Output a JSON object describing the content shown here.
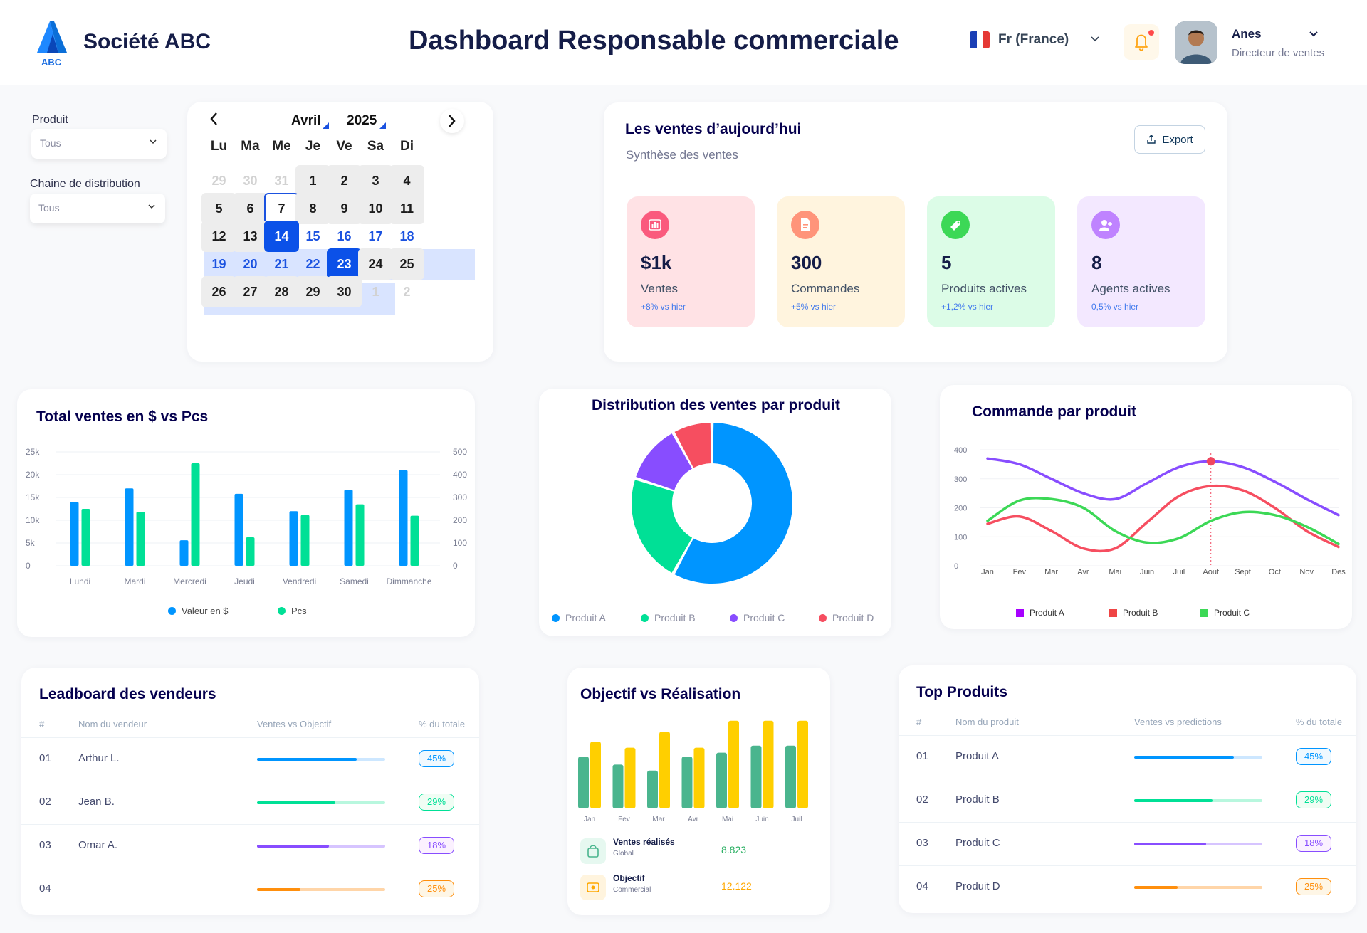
{
  "header": {
    "brand_logo_text": "ABC",
    "company": "Société ABC",
    "title": "Dashboard Responsable commerciale",
    "language": "Fr (France)",
    "user_name": "Anes",
    "user_role": "Directeur de ventes"
  },
  "filters": {
    "product_label": "Produit",
    "product_value": "Tous",
    "channel_label": "Chaine de distribution",
    "channel_value": "Tous"
  },
  "calendar": {
    "month": "Avril",
    "year": "2025",
    "weekdays": [
      "Lu",
      "Ma",
      "Me",
      "Je",
      "Ve",
      "Sa",
      "Di"
    ],
    "rows": [
      [
        "29",
        "30",
        "31",
        "1",
        "2",
        "3",
        "4"
      ],
      [
        "5",
        "6",
        "7",
        "8",
        "9",
        "10",
        "11"
      ],
      [
        "12",
        "13",
        "14",
        "15",
        "16",
        "17",
        "18"
      ],
      [
        "19",
        "20",
        "21",
        "22",
        "23",
        "24",
        "25"
      ],
      [
        "26",
        "27",
        "28",
        "29",
        "30",
        "1",
        "2"
      ]
    ]
  },
  "sales_today": {
    "title": "Les ventes d’aujourd’hui",
    "subtitle": "Synthèse des ventes",
    "export_label": "Export",
    "kpis": [
      {
        "value": "$1k",
        "label": "Ventes",
        "change": "+8%  vs hier",
        "bg": "#ffe2e5",
        "icon_bg": "#fa5a7d"
      },
      {
        "value": "300",
        "label": "Commandes",
        "change": "+5% vs hier",
        "bg": "#fff4de",
        "icon_bg": "#ff947a"
      },
      {
        "value": "5",
        "label": "Produits actives",
        "change": "+1,2% vs hier",
        "bg": "#dcfce7",
        "icon_bg": "#3cd856"
      },
      {
        "value": "8",
        "label": "Agents actives",
        "change": "0,5% vs hier",
        "bg": "#f3e8ff",
        "icon_bg": "#bf83ff"
      }
    ]
  },
  "total_sales": {
    "title": "Total ventes en $ vs Pcs",
    "legend": [
      "Valeur en $",
      "Pcs"
    ]
  },
  "distribution": {
    "title": "Distribution des ventes par produit",
    "legend": [
      "Produit A",
      "Produit B",
      "Produit C",
      "Produit D"
    ]
  },
  "orders": {
    "title": "Commande par produit",
    "legend": [
      "Produit A",
      "Produit B",
      "Produit C"
    ]
  },
  "objective": {
    "title": "Objectif vs Réalisation",
    "rows": [
      {
        "label": "Ventes réalisés",
        "sub": "Global",
        "value": "8.823"
      },
      {
        "label": "Objectif",
        "sub": "Commercial",
        "value": "12.122"
      }
    ]
  },
  "leaderboard": {
    "title": "Leadboard des vendeurs",
    "headers": [
      "#",
      "Nom du vendeur",
      "Ventes vs Objectif",
      "% du totale"
    ],
    "rows": [
      {
        "rank": "01",
        "name": "Arthur L.",
        "pct": "45%",
        "progress": 0.78
      },
      {
        "rank": "02",
        "name": "Jean B.",
        "pct": "29%",
        "progress": 0.61
      },
      {
        "rank": "03",
        "name": "Omar A.",
        "pct": "18%",
        "progress": 0.56
      },
      {
        "rank": "04",
        "name": "",
        "pct": "25%",
        "progress": 0.34
      }
    ]
  },
  "top_products": {
    "title": "Top Produits",
    "headers": [
      "#",
      "Nom du produit",
      "Ventes vs predictions",
      "% du totale"
    ],
    "rows": [
      {
        "rank": "01",
        "name": "Produit A",
        "pct": "45%",
        "progress": 0.78
      },
      {
        "rank": "02",
        "name": "Produit B",
        "pct": "29%",
        "progress": 0.61
      },
      {
        "rank": "03",
        "name": "Produit C",
        "pct": "18%",
        "progress": 0.56
      },
      {
        "rank": "04",
        "name": "Produit D",
        "pct": "25%",
        "progress": 0.34
      }
    ]
  },
  "colors": {
    "blue": "#0095ff",
    "green": "#00e096",
    "purple": "#884dff",
    "orange": "#ff8f0d",
    "red": "#f64e60",
    "navy": "#151d48"
  },
  "chart_data": [
    {
      "type": "bar",
      "categories": [
        "Lundi",
        "Mardi",
        "Mercredi",
        "Jeudi",
        "Vendredi",
        "Samedi",
        "Dimmanche"
      ],
      "series": [
        {
          "name": "Valeur en $",
          "axis": "left",
          "values": [
            14000,
            17000,
            5600,
            15800,
            12000,
            16700,
            21000
          ]
        },
        {
          "name": "Pcs",
          "axis": "right",
          "values": [
            250,
            237,
            450,
            125,
            223,
            270,
            220
          ]
        }
      ],
      "y_ticks": [
        "0",
        "5k",
        "10k",
        "15k",
        "20k",
        "25k"
      ],
      "y2_ticks": [
        "0",
        "100",
        "200",
        "300",
        "400",
        "500"
      ],
      "ylim": [
        0,
        25000
      ],
      "y2lim": [
        0,
        500
      ],
      "grid": true
    },
    {
      "type": "pie",
      "donut": true,
      "categories": [
        "Produit A",
        "Produit B",
        "Produit C",
        "Produit D"
      ],
      "values": [
        58,
        22,
        12,
        8
      ]
    },
    {
      "type": "line",
      "categories": [
        "Jan",
        "Fev",
        "Mar",
        "Avr",
        "Mai",
        "Juin",
        "Juil",
        "Aout",
        "Sept",
        "Oct",
        "Nov",
        "Des"
      ],
      "series": [
        {
          "name": "Produit A",
          "values": [
            370,
            350,
            300,
            250,
            230,
            285,
            340,
            360,
            340,
            290,
            230,
            175
          ]
        },
        {
          "name": "Produit B",
          "values": [
            145,
            170,
            120,
            60,
            60,
            150,
            240,
            275,
            260,
            200,
            120,
            65
          ]
        },
        {
          "name": "Produit C",
          "values": [
            155,
            225,
            230,
            200,
            120,
            80,
            95,
            155,
            185,
            175,
            135,
            75
          ]
        }
      ],
      "y_ticks": [
        "0",
        "100",
        "200",
        "300",
        "400"
      ],
      "ylim": [
        0,
        400
      ],
      "highlight": "Aout"
    },
    {
      "type": "bar",
      "categories": [
        "Jan",
        "Fev",
        "Mar",
        "Avr",
        "Mai",
        "Juin",
        "Juil"
      ],
      "series": [
        {
          "name": "Ventes réalisés",
          "values": [
            5.2,
            4.4,
            3.8,
            5.2,
            5.6,
            6.3,
            6.3
          ]
        },
        {
          "name": "Objectif",
          "values": [
            6.7,
            6.1,
            7.7,
            6.1,
            8.8,
            8.8,
            8.8
          ]
        }
      ]
    }
  ]
}
